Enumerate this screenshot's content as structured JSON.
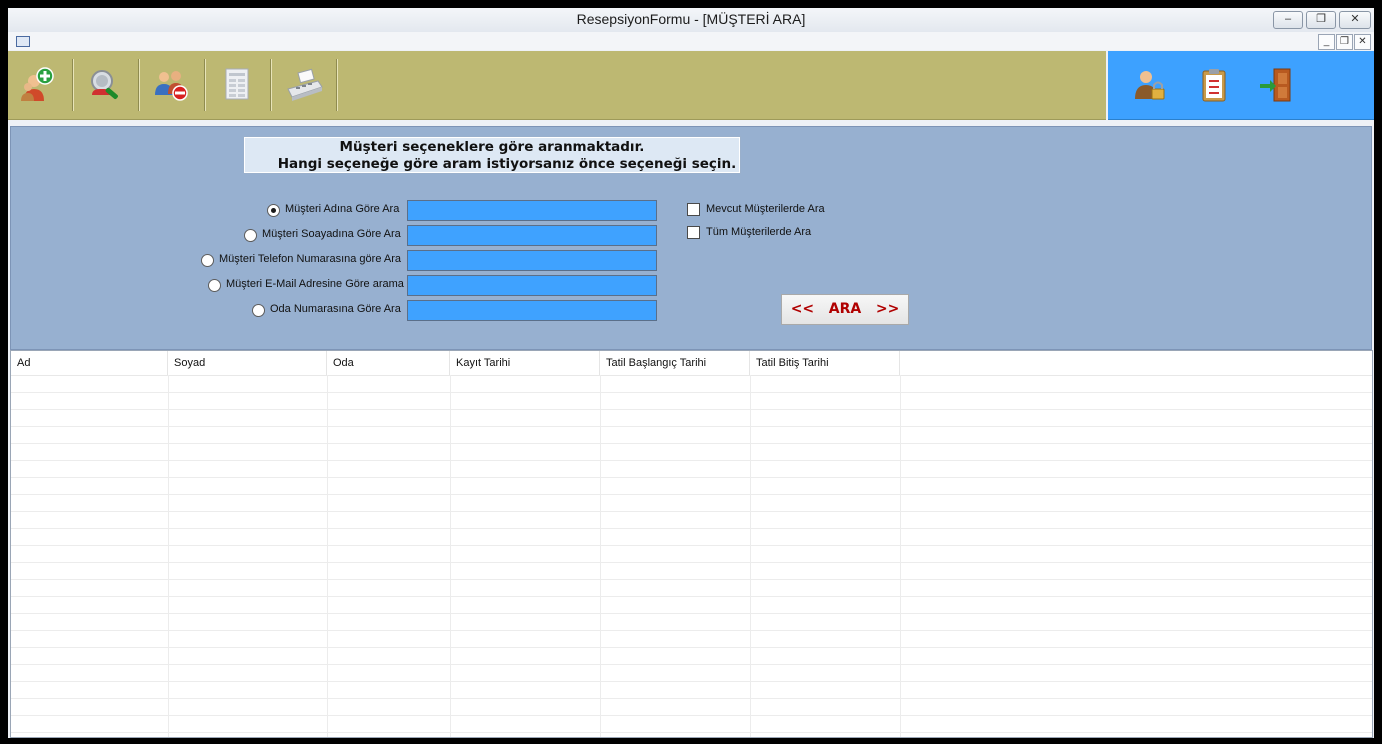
{
  "window": {
    "title": "ResepsiyonFormu - [MÜŞTERİ   ARA]",
    "controls": {
      "minimize": "–",
      "restore": "❐",
      "close": "✕"
    }
  },
  "mdi_controls": {
    "minimize": "_",
    "restore": "❐",
    "close": "✕"
  },
  "toolbar": {
    "left_tools": [
      {
        "name": "add-customer",
        "icon": "person-add-icon"
      },
      {
        "name": "search-customer",
        "icon": "magnifier-icon"
      },
      {
        "name": "remove-customer",
        "icon": "people-remove-icon"
      },
      {
        "name": "report",
        "icon": "spreadsheet-icon"
      },
      {
        "name": "payment",
        "icon": "cash-register-icon"
      }
    ],
    "right_tools": [
      {
        "name": "user-lock",
        "icon": "user-lock-icon"
      },
      {
        "name": "clipboard",
        "icon": "clipboard-icon"
      },
      {
        "name": "exit",
        "icon": "exit-door-icon"
      }
    ],
    "colors": {
      "left_bg": "#bdb872",
      "right_bg": "#3da1ff"
    }
  },
  "search": {
    "info_line1": "Müşteri seçeneklere göre aranmaktadır.",
    "info_line2": "Hangi seçeneğe göre aram istiyorsanız önce seçeneği seçin.",
    "options": [
      {
        "label": "Müşteri Adına Göre Ara",
        "checked": true,
        "value": ""
      },
      {
        "label": "Müşteri Soayadına Göre Ara",
        "checked": false,
        "value": ""
      },
      {
        "label": "Müşteri Telefon Numarasına göre Ara",
        "checked": false,
        "value": ""
      },
      {
        "label": "Müşteri E-Mail Adresine Göre arama",
        "checked": false,
        "value": ""
      },
      {
        "label": "Oda Numarasına Göre Ara",
        "checked": false,
        "value": ""
      }
    ],
    "checkboxes": [
      {
        "label": "Mevcut Müşterilerde Ara",
        "checked": false
      },
      {
        "label": "Tüm Müşterilerde Ara",
        "checked": false
      }
    ],
    "button_label": "<<   ARA   >>",
    "input_color": "#3fa2ff",
    "panel_color": "#97b0d0"
  },
  "grid": {
    "columns": [
      "Ad",
      "Soyad",
      "Oda",
      "Kayıt Tarihi",
      "Tatil Başlangıç Tarihi",
      "Tatil Bitiş Tarihi"
    ],
    "rows": []
  }
}
